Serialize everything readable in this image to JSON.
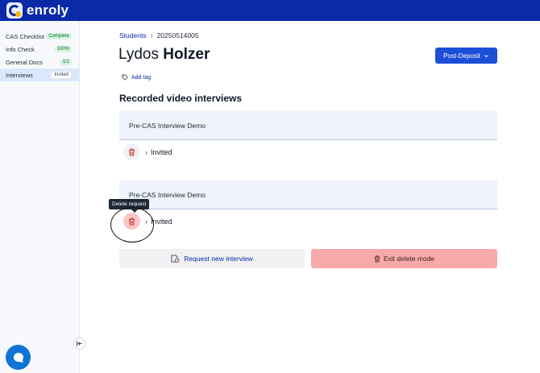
{
  "app": {
    "brand": "enroly"
  },
  "sidebar": {
    "items": [
      {
        "label": "CAS Checklist",
        "badge": "Complete"
      },
      {
        "label": "Info Check",
        "badge": "100%"
      },
      {
        "label": "General Docs",
        "badge": "1/1"
      },
      {
        "label": "Interviews",
        "badge": "Invited"
      }
    ]
  },
  "breadcrumb": {
    "parent": "Students",
    "current": "20250514005"
  },
  "student": {
    "first_name": "Lydos",
    "last_name": "Holzer"
  },
  "header": {
    "status_button": "Post-Deposit"
  },
  "tags": {
    "add_label": "Add tag"
  },
  "section": {
    "title": "Recorded video interviews"
  },
  "interviews": [
    {
      "title": "Pre-CAS Interview Demo",
      "status": "Invited"
    },
    {
      "title": "Pre-CAS Interview Demo",
      "status": "Invited"
    }
  ],
  "tooltip": {
    "text": "Delete request"
  },
  "actions": {
    "request_new": "Request new interview",
    "exit_delete": "Exit delete mode"
  },
  "colors": {
    "brand": "#0b2aa8",
    "primary": "#1d4ed8",
    "danger_soft": "#f8a9a9"
  }
}
